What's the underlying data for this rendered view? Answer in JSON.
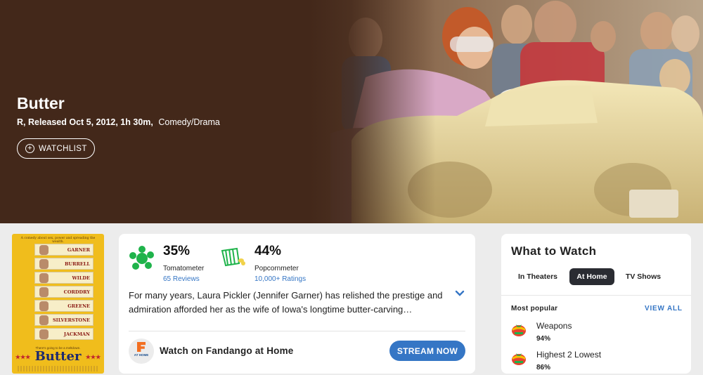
{
  "hero": {
    "title": "Butter",
    "rating_release": "R, Released Oct 5, 2012, 1h 30m,",
    "genre": "Comedy/Drama",
    "watchlist_label": "WATCHLIST"
  },
  "poster": {
    "tagline": "A comedy about sex, power and spreading the wealth.",
    "cast": [
      "GARNER",
      "BURRELL",
      "WILDE",
      "CORDDRY",
      "GREENE",
      "SILVERSTONE",
      "JACKMAN"
    ],
    "sub": "There's going to be a meltdown.",
    "title": "Butter",
    "stars": "★★★"
  },
  "scores": {
    "tomatometer": {
      "value": "35%",
      "label": "Tomatometer",
      "link": "65 Reviews"
    },
    "popcornmeter": {
      "value": "44%",
      "label": "Popcornmeter",
      "link": "10,000+ Ratings"
    },
    "synopsis": "For many years, Laura Pickler (Jennifer Garner) has relished the prestige and admiration afforded her as the wife of Iowa's longtime butter-carving…",
    "fandango_logo_text": "AT HOME",
    "fandango_label": "Watch on Fandango at Home",
    "stream_label": "STREAM NOW",
    "colors": {
      "accent": "#3576c5",
      "tomato_splat": "#1fb34b",
      "popcorn": "#1fb34b"
    }
  },
  "what_to_watch": {
    "title": "What to Watch",
    "tabs": [
      {
        "label": "In Theaters",
        "active": false
      },
      {
        "label": "At Home",
        "active": true
      },
      {
        "label": "TV Shows",
        "active": false
      }
    ],
    "most_popular_label": "Most popular",
    "view_all_label": "VIEW ALL",
    "items": [
      {
        "name": "Weapons",
        "score": "94%"
      },
      {
        "name": "Highest 2 Lowest",
        "score": "86%"
      }
    ]
  }
}
